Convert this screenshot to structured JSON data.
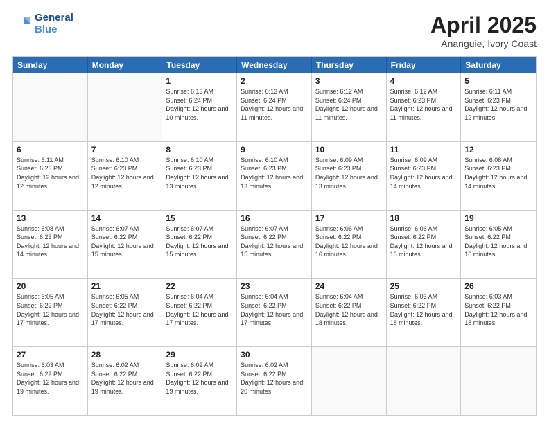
{
  "header": {
    "logo_line1": "General",
    "logo_line2": "Blue",
    "month": "April 2025",
    "location": "Ananguie, Ivory Coast"
  },
  "weekdays": [
    "Sunday",
    "Monday",
    "Tuesday",
    "Wednesday",
    "Thursday",
    "Friday",
    "Saturday"
  ],
  "rows": [
    [
      {
        "day": "",
        "info": ""
      },
      {
        "day": "",
        "info": ""
      },
      {
        "day": "1",
        "info": "Sunrise: 6:13 AM\nSunset: 6:24 PM\nDaylight: 12 hours and 10 minutes."
      },
      {
        "day": "2",
        "info": "Sunrise: 6:13 AM\nSunset: 6:24 PM\nDaylight: 12 hours and 11 minutes."
      },
      {
        "day": "3",
        "info": "Sunrise: 6:12 AM\nSunset: 6:24 PM\nDaylight: 12 hours and 11 minutes."
      },
      {
        "day": "4",
        "info": "Sunrise: 6:12 AM\nSunset: 6:23 PM\nDaylight: 12 hours and 11 minutes."
      },
      {
        "day": "5",
        "info": "Sunrise: 6:11 AM\nSunset: 6:23 PM\nDaylight: 12 hours and 12 minutes."
      }
    ],
    [
      {
        "day": "6",
        "info": "Sunrise: 6:11 AM\nSunset: 6:23 PM\nDaylight: 12 hours and 12 minutes."
      },
      {
        "day": "7",
        "info": "Sunrise: 6:10 AM\nSunset: 6:23 PM\nDaylight: 12 hours and 12 minutes."
      },
      {
        "day": "8",
        "info": "Sunrise: 6:10 AM\nSunset: 6:23 PM\nDaylight: 12 hours and 13 minutes."
      },
      {
        "day": "9",
        "info": "Sunrise: 6:10 AM\nSunset: 6:23 PM\nDaylight: 12 hours and 13 minutes."
      },
      {
        "day": "10",
        "info": "Sunrise: 6:09 AM\nSunset: 6:23 PM\nDaylight: 12 hours and 13 minutes."
      },
      {
        "day": "11",
        "info": "Sunrise: 6:09 AM\nSunset: 6:23 PM\nDaylight: 12 hours and 14 minutes."
      },
      {
        "day": "12",
        "info": "Sunrise: 6:08 AM\nSunset: 6:23 PM\nDaylight: 12 hours and 14 minutes."
      }
    ],
    [
      {
        "day": "13",
        "info": "Sunrise: 6:08 AM\nSunset: 6:23 PM\nDaylight: 12 hours and 14 minutes."
      },
      {
        "day": "14",
        "info": "Sunrise: 6:07 AM\nSunset: 6:22 PM\nDaylight: 12 hours and 15 minutes."
      },
      {
        "day": "15",
        "info": "Sunrise: 6:07 AM\nSunset: 6:22 PM\nDaylight: 12 hours and 15 minutes."
      },
      {
        "day": "16",
        "info": "Sunrise: 6:07 AM\nSunset: 6:22 PM\nDaylight: 12 hours and 15 minutes."
      },
      {
        "day": "17",
        "info": "Sunrise: 6:06 AM\nSunset: 6:22 PM\nDaylight: 12 hours and 16 minutes."
      },
      {
        "day": "18",
        "info": "Sunrise: 6:06 AM\nSunset: 6:22 PM\nDaylight: 12 hours and 16 minutes."
      },
      {
        "day": "19",
        "info": "Sunrise: 6:05 AM\nSunset: 6:22 PM\nDaylight: 12 hours and 16 minutes."
      }
    ],
    [
      {
        "day": "20",
        "info": "Sunrise: 6:05 AM\nSunset: 6:22 PM\nDaylight: 12 hours and 17 minutes."
      },
      {
        "day": "21",
        "info": "Sunrise: 6:05 AM\nSunset: 6:22 PM\nDaylight: 12 hours and 17 minutes."
      },
      {
        "day": "22",
        "info": "Sunrise: 6:04 AM\nSunset: 6:22 PM\nDaylight: 12 hours and 17 minutes."
      },
      {
        "day": "23",
        "info": "Sunrise: 6:04 AM\nSunset: 6:22 PM\nDaylight: 12 hours and 17 minutes."
      },
      {
        "day": "24",
        "info": "Sunrise: 6:04 AM\nSunset: 6:22 PM\nDaylight: 12 hours and 18 minutes."
      },
      {
        "day": "25",
        "info": "Sunrise: 6:03 AM\nSunset: 6:22 PM\nDaylight: 12 hours and 18 minutes."
      },
      {
        "day": "26",
        "info": "Sunrise: 6:03 AM\nSunset: 6:22 PM\nDaylight: 12 hours and 18 minutes."
      }
    ],
    [
      {
        "day": "27",
        "info": "Sunrise: 6:03 AM\nSunset: 6:22 PM\nDaylight: 12 hours and 19 minutes."
      },
      {
        "day": "28",
        "info": "Sunrise: 6:02 AM\nSunset: 6:22 PM\nDaylight: 12 hours and 19 minutes."
      },
      {
        "day": "29",
        "info": "Sunrise: 6:02 AM\nSunset: 6:22 PM\nDaylight: 12 hours and 19 minutes."
      },
      {
        "day": "30",
        "info": "Sunrise: 6:02 AM\nSunset: 6:22 PM\nDaylight: 12 hours and 20 minutes."
      },
      {
        "day": "",
        "info": ""
      },
      {
        "day": "",
        "info": ""
      },
      {
        "day": "",
        "info": ""
      }
    ]
  ]
}
